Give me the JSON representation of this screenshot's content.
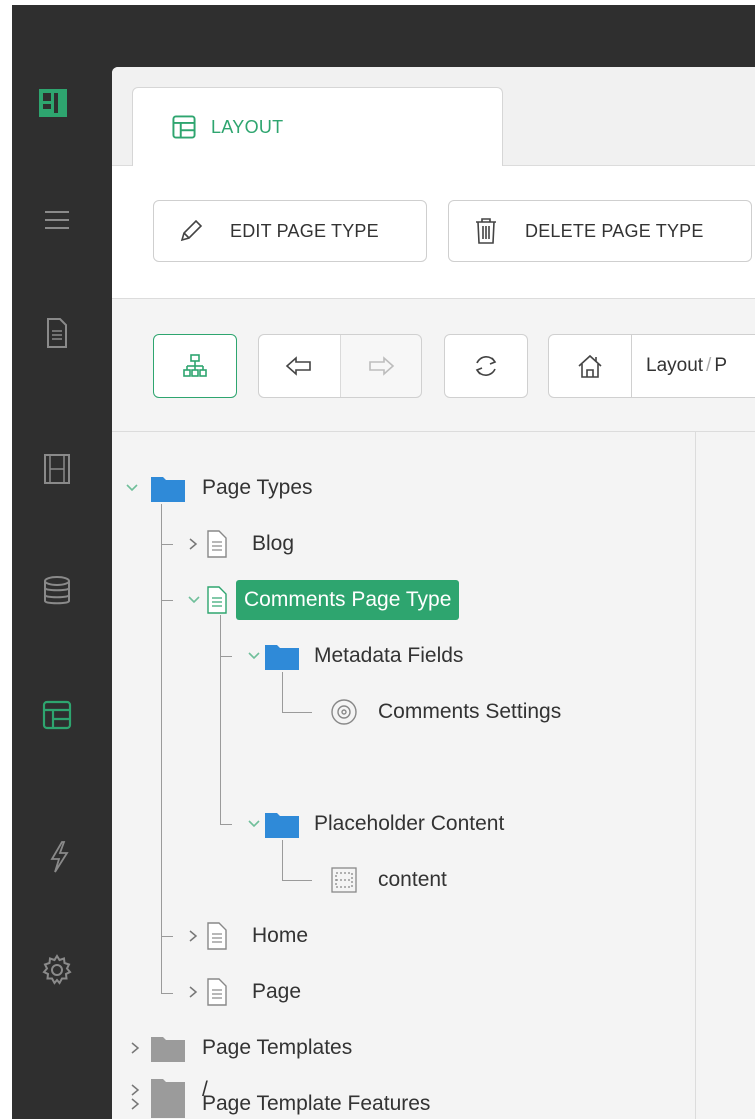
{
  "colors": {
    "accent": "#2ea56f",
    "sidebar": "#2f2f2f",
    "folder_blue": "#2f8ad8",
    "folder_gray": "#9b9b9b"
  },
  "sidebar": {
    "items": [
      {
        "icon": "logo-icon"
      },
      {
        "icon": "menu-icon"
      },
      {
        "icon": "page-icon"
      },
      {
        "icon": "media-icon"
      },
      {
        "icon": "database-icon"
      },
      {
        "icon": "layout-icon",
        "active": true
      },
      {
        "icon": "lightning-icon"
      },
      {
        "icon": "gear-icon"
      }
    ]
  },
  "tabs": [
    {
      "label": "LAYOUT",
      "icon": "layout-icon",
      "active": true
    }
  ],
  "toolbar": {
    "edit_label": "EDIT PAGE TYPE",
    "delete_label": "DELETE PAGE TYPE"
  },
  "navbar": {
    "breadcrumb_text": "Layout",
    "breadcrumb_sep": "/",
    "breadcrumb_next": "P"
  },
  "tree": {
    "root": "Page Types",
    "blog": "Blog",
    "comments": "Comments Page Type",
    "metadata": "Metadata Fields",
    "comments_settings": "Comments Settings",
    "placeholder": "Placeholder Content",
    "content": "content",
    "home": "Home",
    "page": "Page",
    "templates": "Page Templates",
    "template_features": "Page Template Features",
    "slash": "/"
  }
}
